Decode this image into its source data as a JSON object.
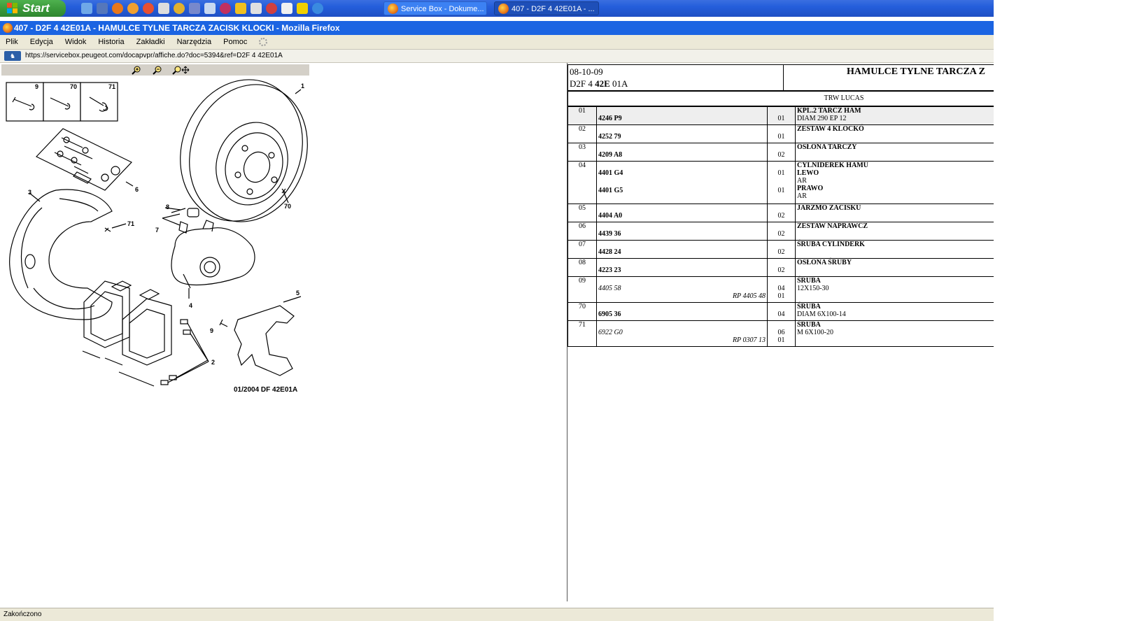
{
  "taskbar": {
    "start_label": "Start",
    "tasks": [
      {
        "label": "Service Box - Dokume..."
      },
      {
        "label": "407 - D2F 4 42E01A - ..."
      }
    ]
  },
  "window": {
    "title": "407 - D2F 4 42E01A - HAMULCE TYLNE TARCZA ZACISK KLOCKI - Mozilla Firefox"
  },
  "menu": [
    "Plik",
    "Edycja",
    "Widok",
    "Historia",
    "Zakładki",
    "Narzędzia",
    "Pomoc"
  ],
  "address": {
    "url": "https://servicebox.peugeot.com/docapvpr/affiche.do?doc=5394&ref=D2F  4 42E01A"
  },
  "drawing": {
    "callouts": [
      "9",
      "70",
      "71",
      "1",
      "6",
      "3",
      "8",
      "7",
      "71",
      "70",
      "4",
      "5",
      "9",
      "2"
    ],
    "caption": "01/2004   DF 42E01A"
  },
  "parts_sheet": {
    "date": "08-10-09",
    "code_prefix": "D2F 4 ",
    "code_bold": "42E",
    "code_suffix": " 01A",
    "title": "HAMULCE TYLNE TARCZA Z",
    "supplier": "TRW LUCAS",
    "rows": [
      {
        "ref": "01",
        "pn": "4246 P9",
        "qty": "01",
        "desc": "KPL.2 TARCZ HAM",
        "sub": "DIAM 290 EP 12"
      },
      {
        "ref": "02",
        "pn": "4252 79",
        "qty": "01",
        "desc": "ZESTAW 4 KLOCKÓ",
        "sub": ""
      },
      {
        "ref": "03",
        "pn": "4209 A8",
        "qty": "02",
        "desc": "OSŁONA TARCZY",
        "sub": ""
      },
      {
        "ref": "04",
        "pn": "4401 G4",
        "qty": "01",
        "desc": "CYLNIDEREK HAMU",
        "sub": "LEWO",
        "sub2": "AR",
        "pn2": "4401 G5",
        "qty2": "01",
        "desc2": "PRAWO",
        "sub3": "AR"
      },
      {
        "ref": "05",
        "pn": "4404 A0",
        "qty": "02",
        "desc": "JARZMO ZACISKU",
        "sub": ""
      },
      {
        "ref": "06",
        "pn": "4439 36",
        "qty": "02",
        "desc": "ZESTAW NAPRAWCZ",
        "sub": ""
      },
      {
        "ref": "07",
        "pn": "4428 24",
        "qty": "02",
        "desc": "ŚRUBA CYLINDERK",
        "sub": ""
      },
      {
        "ref": "08",
        "pn": "4223 23",
        "qty": "02",
        "desc": "OSŁONA ŚRUBY",
        "sub": ""
      },
      {
        "ref": "09",
        "pn": "4405 58",
        "rp": "RP 4405 48",
        "qty": "04",
        "qty2": "01",
        "desc": "ŚRUBA",
        "sub": "12X150-30"
      },
      {
        "ref": "70",
        "pn": "6905 36",
        "qty": "04",
        "desc": "ŚRUBA",
        "sub": "DIAM 6X100-14"
      },
      {
        "ref": "71",
        "pn": "6922 G0",
        "rp": "RP 0307 13",
        "qty": "06",
        "qty2": "01",
        "desc": "ŚRUBA",
        "sub": "M 6X100-20"
      }
    ]
  },
  "status": {
    "text": "Zakończono"
  }
}
